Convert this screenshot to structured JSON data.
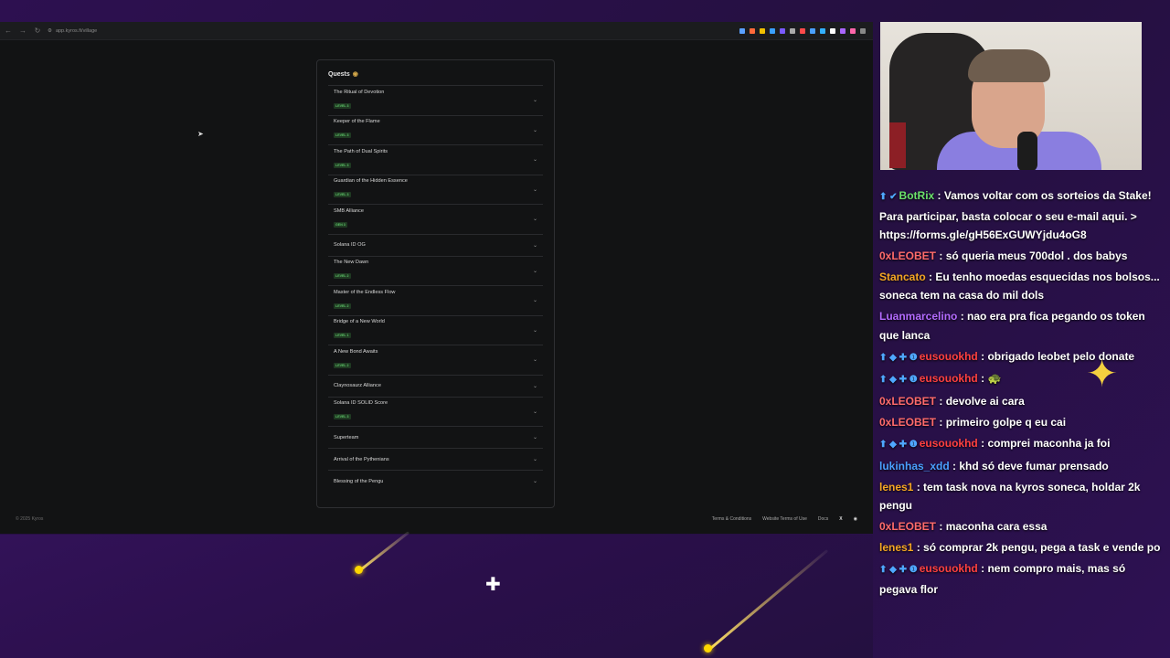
{
  "browser": {
    "url": "app.kyros.fi/village",
    "extension_colors": [
      "#5aa0ff",
      "#ff6a3a",
      "#f0c000",
      "#3aa0ff",
      "#7a5aff",
      "#aaaaaa",
      "#ff4a4a",
      "#4aa0ff",
      "#33b0ff",
      "#ffffff",
      "#aa66ff",
      "#ff66aa",
      "#888888"
    ]
  },
  "quests_panel": {
    "title": "Quests",
    "title_icon": "coin-icon",
    "items": [
      {
        "name": "The Ritual of Devotion",
        "badge": "LEVEL 3"
      },
      {
        "name": "Keeper of the Flame",
        "badge": "LEVEL 3"
      },
      {
        "name": "The Path of Dual Spirits",
        "badge": "LEVEL 3"
      },
      {
        "name": "Guardian of the Hidden Essence",
        "badge": "LEVEL 3"
      },
      {
        "name": "SMB Alliance",
        "badge": "GEN 3"
      },
      {
        "name": "Solana ID OG",
        "badge": ""
      },
      {
        "name": "The New Dawn",
        "badge": "LEVEL 2"
      },
      {
        "name": "Master of the Endless Flow",
        "badge": "LEVEL 2"
      },
      {
        "name": "Bridge of a New World",
        "badge": "LEVEL 1"
      },
      {
        "name": "A New Bond Awaits",
        "badge": "LEVEL 2"
      },
      {
        "name": "Claynosaurz Alliance",
        "badge": ""
      },
      {
        "name": "Solana ID SOLID Score",
        "badge": "LEVEL 3"
      },
      {
        "name": "Superteam",
        "badge": ""
      },
      {
        "name": "Arrival of the Pythenians",
        "badge": ""
      },
      {
        "name": "Blessing of the Pengu",
        "badge": ""
      }
    ]
  },
  "footer": {
    "copyright": "© 2025 Kyros",
    "links": [
      "Terms & Conditions",
      "Website Terms of Use",
      "Docs"
    ],
    "social_x": "X"
  },
  "chat": {
    "messages": [
      {
        "user": "BotRix",
        "color": "#6be26b",
        "badges": "⬆ ✔",
        "text": "Vamos voltar com os sorteios da Stake! Para participar, basta colocar o seu e-mail aqui. > https://forms.gle/gH56ExGUWYjdu4oG8"
      },
      {
        "user": "0xLEOBET",
        "color": "#ff6b6b",
        "badges": "",
        "text": "só queria meus 700dol . dos babys"
      },
      {
        "user": "Stancato",
        "color": "#f5a623",
        "badges": "",
        "text": "Eu tenho moedas esquecidas nos bolsos... soneca tem na casa do mil dols"
      },
      {
        "user": "Luanmarcelino",
        "color": "#b36bff",
        "badges": "",
        "text": "nao era pra fica pegando os token que lanca"
      },
      {
        "user": "eusouokhd",
        "color": "#ff4040",
        "badges": "⬆ ◆ ✚ ❶",
        "text": "obrigado leobet pelo donate"
      },
      {
        "user": "eusouokhd",
        "color": "#ff4040",
        "badges": "⬆ ◆ ✚ ❶",
        "text": "🐢"
      },
      {
        "user": "0xLEOBET",
        "color": "#ff6b6b",
        "badges": "",
        "text": "devolve ai cara"
      },
      {
        "user": "0xLEOBET",
        "color": "#ff6b6b",
        "badges": "",
        "text": "primeiro golpe q eu cai"
      },
      {
        "user": "eusouokhd",
        "color": "#ff4040",
        "badges": "⬆ ◆ ✚ ❶",
        "text": "comprei maconha ja foi"
      },
      {
        "user": "lukinhas_xdd",
        "color": "#4a9fff",
        "badges": "",
        "text": "khd só deve fumar prensado"
      },
      {
        "user": "lenes1",
        "color": "#f5a623",
        "badges": "",
        "text": "tem task nova na kyros soneca, holdar 2k pengu"
      },
      {
        "user": "0xLEOBET",
        "color": "#ff6b6b",
        "badges": "",
        "text": "maconha cara essa"
      },
      {
        "user": "lenes1",
        "color": "#f5a623",
        "badges": "",
        "text": "só comprar 2k pengu, pega a task e vende po"
      },
      {
        "user": "eusouokhd",
        "color": "#ff4040",
        "badges": "⬆ ◆ ✚ ❶",
        "text": "nem compro mais, mas só pegava flor"
      }
    ]
  }
}
